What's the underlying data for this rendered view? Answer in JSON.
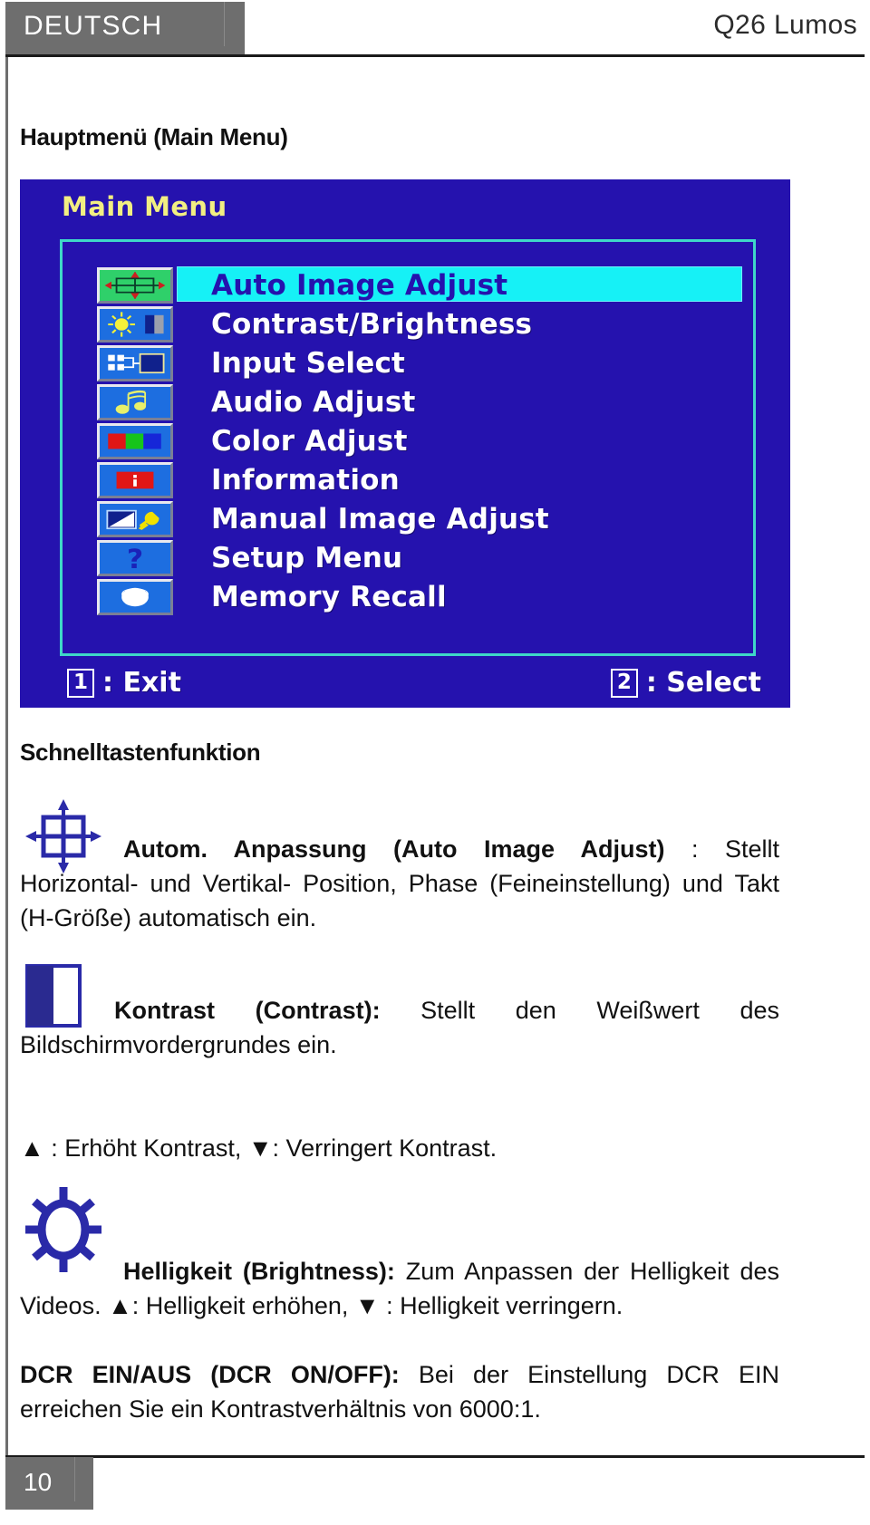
{
  "header": {
    "language": "DEUTSCH",
    "model": "Q26 Lumos"
  },
  "sections": {
    "main_menu_title": "Hauptmenü (Main Menu)",
    "hotkey_title": "Schnelltastenfunktion"
  },
  "osd": {
    "title": "Main Menu",
    "items": [
      {
        "label": "Auto Image Adjust",
        "icon": "auto-image-adjust-icon",
        "selected": true
      },
      {
        "label": "Contrast/Brightness",
        "icon": "contrast-brightness-icon",
        "selected": false
      },
      {
        "label": "Input Select",
        "icon": "input-select-icon",
        "selected": false
      },
      {
        "label": "Audio Adjust",
        "icon": "audio-adjust-icon",
        "selected": false
      },
      {
        "label": "Color Adjust",
        "icon": "color-adjust-icon",
        "selected": false
      },
      {
        "label": "Information",
        "icon": "information-icon",
        "selected": false
      },
      {
        "label": "Manual Image Adjust",
        "icon": "manual-image-adjust-icon",
        "selected": false
      },
      {
        "label": "Setup Menu",
        "icon": "setup-menu-icon",
        "selected": false
      },
      {
        "label": "Memory Recall",
        "icon": "memory-recall-icon",
        "selected": false
      }
    ],
    "footer": {
      "exit_key": "1",
      "exit_label": ": Exit",
      "select_key": "2",
      "select_label": ": Select"
    },
    "colors": {
      "background": "#2512ae",
      "title_text": "#f2ef82",
      "panel_border": "#3fd8c8",
      "highlight": "#16f1f6",
      "icon_tile": "#1d6ee0"
    }
  },
  "hotkeys": [
    {
      "icon": "auto-adjust-crosshair-icon",
      "bold": "Autom. Anpassung (Auto Image Adjust) ",
      "text": ": Stellt Horizontal- und Vertikal- Position, Phase (Feineinstellung) und Takt (H-Größe) automatisch ein."
    },
    {
      "icon": "contrast-half-square-icon",
      "bold": "Kontrast (Contrast): ",
      "text": "Stellt den Weißwert des Bildschirmvordergrundes ein.",
      "extra": "▲ : Erhöht Kontrast, ▼: Verringert Kontrast."
    },
    {
      "icon": "brightness-sun-icon",
      "bold": "Helligkeit (Brightness): ",
      "text": "Zum Anpassen der Helligkeit des Videos. ▲: Helligkeit erhöhen, ▼ : Helligkeit verringern.",
      "bold2": "DCR EIN/AUS (DCR ON/OFF): ",
      "text2": "Bei der Einstellung DCR EIN erreichen Sie ein Kontrastverhältnis von 6000:1."
    }
  ],
  "footer": {
    "page_number": "10"
  }
}
